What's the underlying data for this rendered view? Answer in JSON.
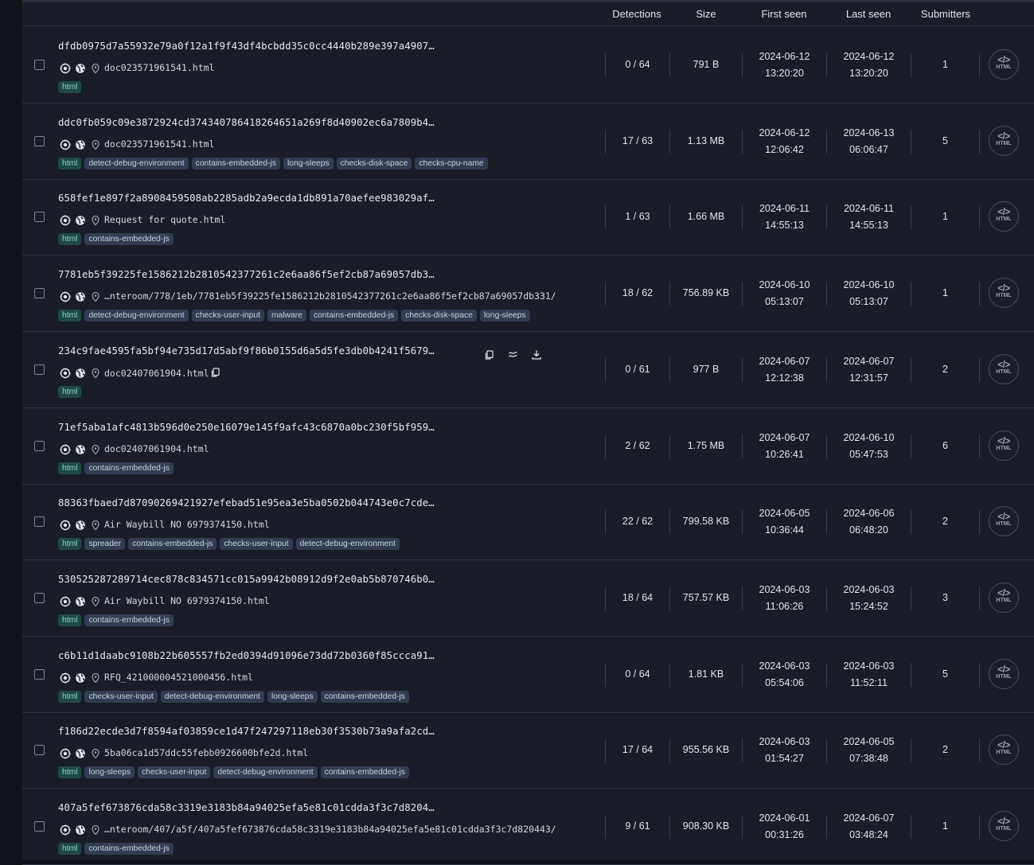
{
  "header": {
    "detections": "Detections",
    "size": "Size",
    "first_seen": "First seen",
    "last_seen": "Last seen",
    "submitters": "Submitters"
  },
  "file_type_badge": {
    "code": "</>",
    "label": "HTML"
  },
  "rows": [
    {
      "hash": "dfdb0975d7a55932e79a0f12a1f9f43df4bcbdd35c0cc4440b289e397a4907…",
      "name": "doc023571961541.html",
      "tags": [
        "html"
      ],
      "detections": "0 / 64",
      "size": "791 B",
      "first_date": "2024-06-12",
      "first_time": "13:20:20",
      "last_date": "2024-06-12",
      "last_time": "13:20:20",
      "submitters": "1"
    },
    {
      "hash": "ddc0fb059c09e3872924cd374340786418264651a269f8d40902ec6a7809b4…",
      "name": "doc023571961541.html",
      "tags": [
        "html",
        "detect-debug-environment",
        "contains-embedded-js",
        "long-sleeps",
        "checks-disk-space",
        "checks-cpu-name"
      ],
      "detections": "17 / 63",
      "size": "1.13 MB",
      "first_date": "2024-06-12",
      "first_time": "12:06:42",
      "last_date": "2024-06-13",
      "last_time": "06:06:47",
      "submitters": "5"
    },
    {
      "hash": "658fef1e897f2a8908459508ab2285adb2a9ecda1db891a70aefee983029af…",
      "name": "Request for quote.html",
      "tags": [
        "html",
        "contains-embedded-js"
      ],
      "detections": "1 / 63",
      "size": "1.66 MB",
      "first_date": "2024-06-11",
      "first_time": "14:55:13",
      "last_date": "2024-06-11",
      "last_time": "14:55:13",
      "submitters": "1"
    },
    {
      "hash": "7781eb5f39225fe1586212b2810542377261c2e6aa86f5ef2cb87a69057db3…",
      "name": "…nteroom/778/1eb/7781eb5f39225fe1586212b2810542377261c2e6aa86f5ef2cb87a69057db331/",
      "tags": [
        "html",
        "detect-debug-environment",
        "checks-user-input",
        "malware",
        "contains-embedded-js",
        "checks-disk-space",
        "long-sleeps"
      ],
      "detections": "18 / 62",
      "size": "756.89 KB",
      "first_date": "2024-06-10",
      "first_time": "05:13:07",
      "last_date": "2024-06-10",
      "last_time": "05:13:07",
      "submitters": "1"
    },
    {
      "hash": "234c9fae4595fa5bf94e735d17d5abf9f86b0155d6a5d5fe3db0b4241f5679…",
      "name": "doc02407061904.html",
      "tags": [
        "html"
      ],
      "detections": "0 / 61",
      "size": "977 B",
      "first_date": "2024-06-07",
      "first_time": "12:12:38",
      "last_date": "2024-06-07",
      "last_time": "12:31:57",
      "submitters": "2",
      "hovered": true
    },
    {
      "hash": "71ef5aba1afc4813b596d0e250e16079e145f9afc43c6870a0bc230f5bf959…",
      "name": "doc02407061904.html",
      "tags": [
        "html",
        "contains-embedded-js"
      ],
      "detections": "2 / 62",
      "size": "1.75 MB",
      "first_date": "2024-06-07",
      "first_time": "10:26:41",
      "last_date": "2024-06-10",
      "last_time": "05:47:53",
      "submitters": "6"
    },
    {
      "hash": "88363fbaed7d87090269421927efebad51e95ea3e5ba0502b044743e0c7cde…",
      "name": "Air Waybill NO 6979374150.html",
      "tags": [
        "html",
        "spreader",
        "contains-embedded-js",
        "checks-user-input",
        "detect-debug-environment"
      ],
      "detections": "22 / 62",
      "size": "799.58 KB",
      "first_date": "2024-06-05",
      "first_time": "10:36:44",
      "last_date": "2024-06-06",
      "last_time": "06:48:20",
      "submitters": "2"
    },
    {
      "hash": "530525287289714cec878c834571cc015a9942b08912d9f2e0ab5b870746b0…",
      "name": "Air Waybill NO 6979374150.html",
      "tags": [
        "html",
        "contains-embedded-js"
      ],
      "detections": "18 / 64",
      "size": "757.57 KB",
      "first_date": "2024-06-03",
      "first_time": "11:06:26",
      "last_date": "2024-06-03",
      "last_time": "15:24:52",
      "submitters": "3"
    },
    {
      "hash": "c6b11d1daabc9108b22b605557fb2ed0394d91096e73dd72b0360f85ccca91…",
      "name": "RFQ_421000004521000456.html",
      "tags": [
        "html",
        "checks-user-input",
        "detect-debug-environment",
        "long-sleeps",
        "contains-embedded-js"
      ],
      "detections": "0 / 64",
      "size": "1.81 KB",
      "first_date": "2024-06-03",
      "first_time": "05:54:06",
      "last_date": "2024-06-03",
      "last_time": "11:52:11",
      "submitters": "5"
    },
    {
      "hash": "f186d22ecde3d7f8594af03859ce1d47f247297118eb30f3530b73a9afa2cd…",
      "name": "5ba06ca1d57ddc55febb0926600bfe2d.html",
      "tags": [
        "html",
        "long-sleeps",
        "checks-user-input",
        "detect-debug-environment",
        "contains-embedded-js"
      ],
      "detections": "17 / 64",
      "size": "955.56 KB",
      "first_date": "2024-06-03",
      "first_time": "01:54:27",
      "last_date": "2024-06-05",
      "last_time": "07:38:48",
      "submitters": "2"
    },
    {
      "hash": "407a5fef673876cda58c3319e3183b84a94025efa5e81c01cdda3f3c7d8204…",
      "name": "…nteroom/407/a5f/407a5fef673876cda58c3319e3183b84a94025efa5e81c01cdda3f3c7d820443/",
      "tags": [
        "html",
        "contains-embedded-js"
      ],
      "detections": "9 / 61",
      "size": "908.30 KB",
      "first_date": "2024-06-01",
      "first_time": "00:31:26",
      "last_date": "2024-06-07",
      "last_time": "03:48:24",
      "submitters": "1"
    }
  ]
}
